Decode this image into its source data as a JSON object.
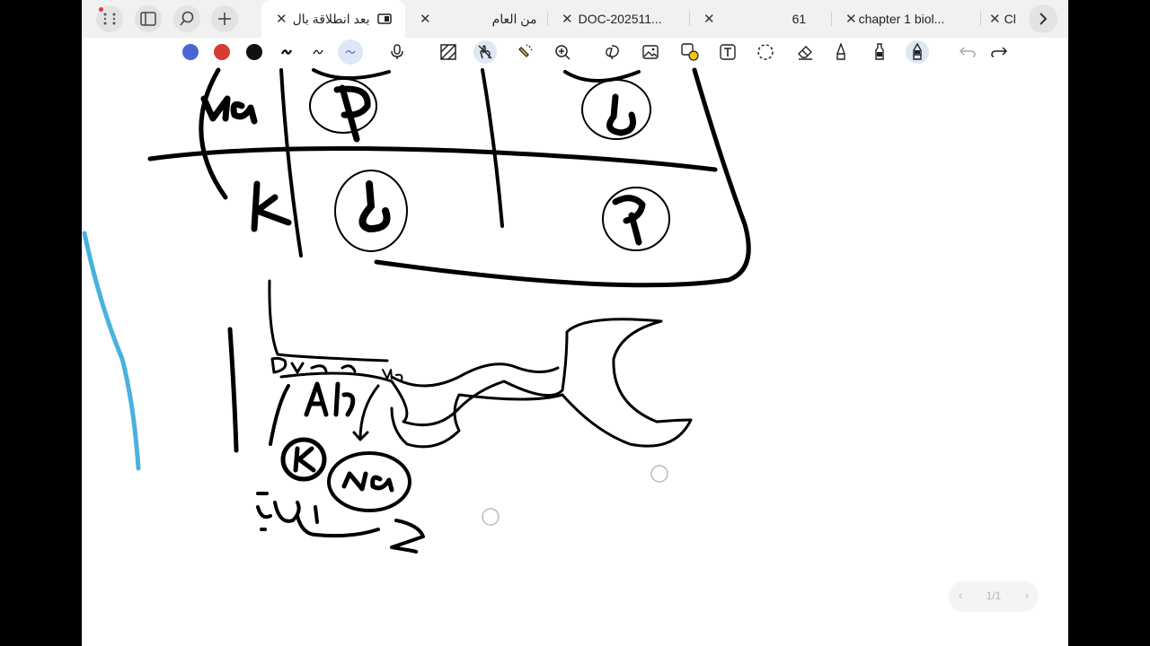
{
  "tabs": [
    {
      "label": "بعد انطلاقة بال",
      "active": true
    },
    {
      "label": "من العام",
      "active": false
    },
    {
      "label": "DOC-202511...",
      "active": false
    },
    {
      "label": "61",
      "active": false
    },
    {
      "label": "chapter 1 biol...",
      "active": false
    },
    {
      "label": "Cl",
      "active": false
    }
  ],
  "toolbar": {
    "colors": [
      "#4a66d4",
      "#d83a34",
      "#111111"
    ],
    "tools": [
      "pen-icon",
      "pen-thin-icon",
      "highlighter-selected-icon",
      "microphone-icon",
      "hatch-icon",
      "touch-draw-icon",
      "magic-marker-icon",
      "zoom-icon",
      "lasso-icon",
      "image-icon",
      "shape-icon",
      "text-icon",
      "selection-icon",
      "eraser-icon",
      "pencil-icon",
      "marker-icon",
      "fountain-pen-icon",
      "undo-icon",
      "redo-icon"
    ]
  },
  "handwriting": {
    "table_row1": "Na",
    "table_row2": "k",
    "label_top": "Dua a a",
    "label_small": "Na",
    "label_atp": "Atp",
    "label_k": "K",
    "label_na": "Na",
    "arabic_note": "سحب"
  },
  "pager": {
    "page": "1/1"
  }
}
